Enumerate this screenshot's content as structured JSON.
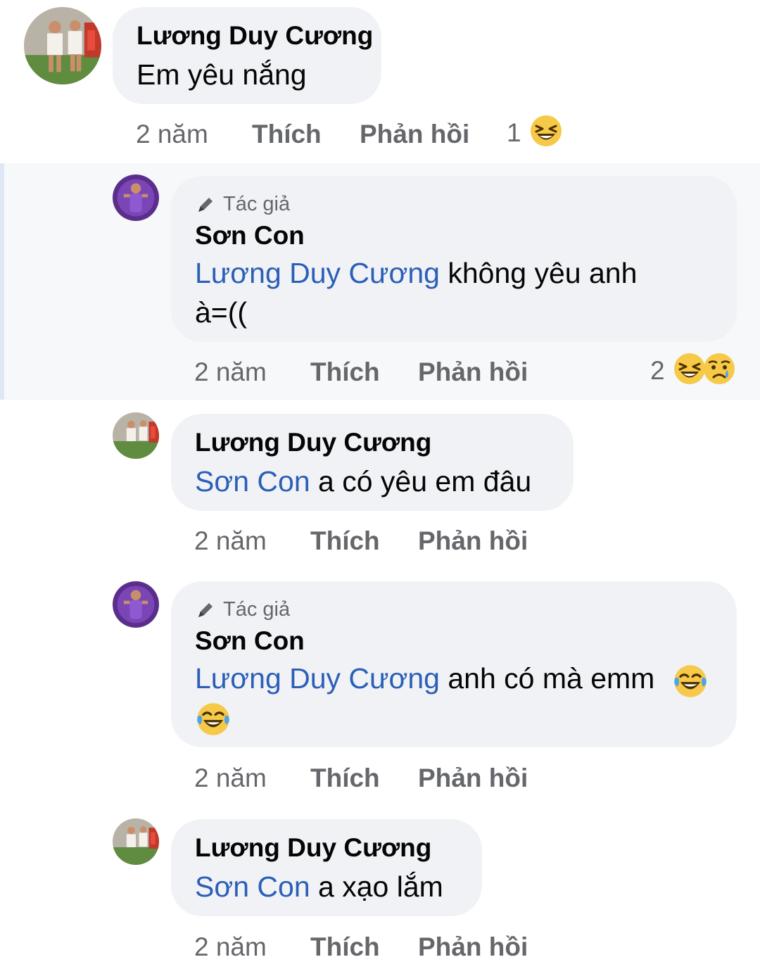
{
  "comments": [
    {
      "author": "Lương Duy Cương",
      "text": "Em yêu nắng",
      "time": "2 năm",
      "like_label": "Thích",
      "reply_label": "Phản hồi",
      "reaction_count": "1"
    },
    {
      "badge": "Tác giả",
      "author": "Sơn Con",
      "mention": "Lương Duy Cương",
      "text_line1": " không yêu anh",
      "text_line2": "à=((",
      "time": "2 năm",
      "like_label": "Thích",
      "reply_label": "Phản hồi",
      "reaction_count": "2"
    },
    {
      "author": "Lương Duy Cương",
      "mention": "Sơn Con",
      "text": " a có yêu em đâu",
      "time": "2 năm",
      "like_label": "Thích",
      "reply_label": "Phản hồi"
    },
    {
      "badge": "Tác giả",
      "author": "Sơn Con",
      "mention": "Lương Duy Cương",
      "text": " anh có mà emm",
      "time": "2 năm",
      "like_label": "Thích",
      "reply_label": "Phản hồi"
    },
    {
      "author": "Lương Duy Cương",
      "mention": "Sơn Con",
      "text": " a xạo lắm",
      "time": "2 năm",
      "like_label": "Thích",
      "reply_label": "Phản hồi"
    }
  ],
  "icons": {
    "author_badge": "pencil-icon",
    "reaction_haha": "laughing-squint-icon",
    "reaction_sad": "crying-face-icon",
    "emoji_tears_of_joy": "tears-of-joy-icon"
  },
  "colors": {
    "mention": "#2b5fb8",
    "bubble": "#f0f2f5",
    "secondary_text": "#65676b"
  }
}
